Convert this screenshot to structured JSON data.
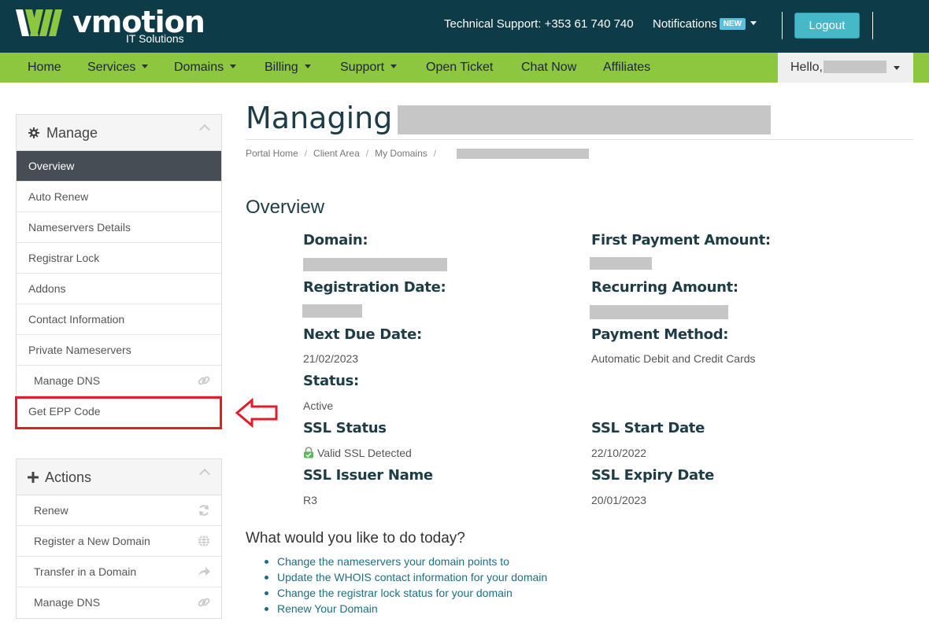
{
  "header": {
    "logo_text": "vmotion",
    "logo_sub": "IT Solutions",
    "support_text": "Technical Support: +353 61 740 740",
    "notifications_label": "Notifications",
    "notifications_badge": "NEW",
    "logout_label": "Logout"
  },
  "nav": {
    "items": [
      "Home",
      "Services",
      "Domains",
      "Billing",
      "Support",
      "Open Ticket",
      "Chat Now",
      "Affiliates"
    ],
    "hello_label": "Hello,"
  },
  "sidebar": {
    "manage_title": "Manage",
    "manage_items": [
      "Overview",
      "Auto Renew",
      "Nameservers Details",
      "Registrar Lock",
      "Addons",
      "Contact Information",
      "Private Nameservers",
      "Manage DNS",
      "Get EPP Code"
    ],
    "actions_title": "Actions",
    "action_items": [
      "Renew",
      "Register a New Domain",
      "Transfer in a Domain",
      "Manage DNS"
    ]
  },
  "main": {
    "title": "Managing",
    "breadcrumb": [
      "Portal Home",
      "Client Area",
      "My Domains"
    ],
    "section_title": "Overview",
    "fields": {
      "domain_label": "Domain:",
      "first_payment_label": "First Payment Amount:",
      "registration_date_label": "Registration Date:",
      "recurring_amount_label": "Recurring Amount:",
      "next_due_label": "Next Due Date:",
      "next_due_value": "21/02/2023",
      "payment_method_label": "Payment Method:",
      "payment_method_value": "Automatic Debit and Credit Cards",
      "status_label": "Status:",
      "status_value": "Active",
      "ssl_status_label": "SSL Status",
      "ssl_status_value": "Valid SSL Detected",
      "ssl_start_label": "SSL Start Date",
      "ssl_start_value": "22/10/2022",
      "ssl_issuer_label": "SSL Issuer Name",
      "ssl_issuer_value": "R3",
      "ssl_expiry_label": "SSL Expiry Date",
      "ssl_expiry_value": "20/01/2023"
    },
    "todo_title": "What would you like to do today?",
    "todo_links": [
      "Change the nameservers your domain points to",
      "Update the WHOIS contact information for your domain",
      "Change the registrar lock status for your domain",
      "Renew Your Domain"
    ]
  },
  "colors": {
    "header_bg": "#0d3b47",
    "nav_bg": "#8dc63f",
    "accent": "#46b8c8",
    "highlight": "#e21d2a"
  }
}
